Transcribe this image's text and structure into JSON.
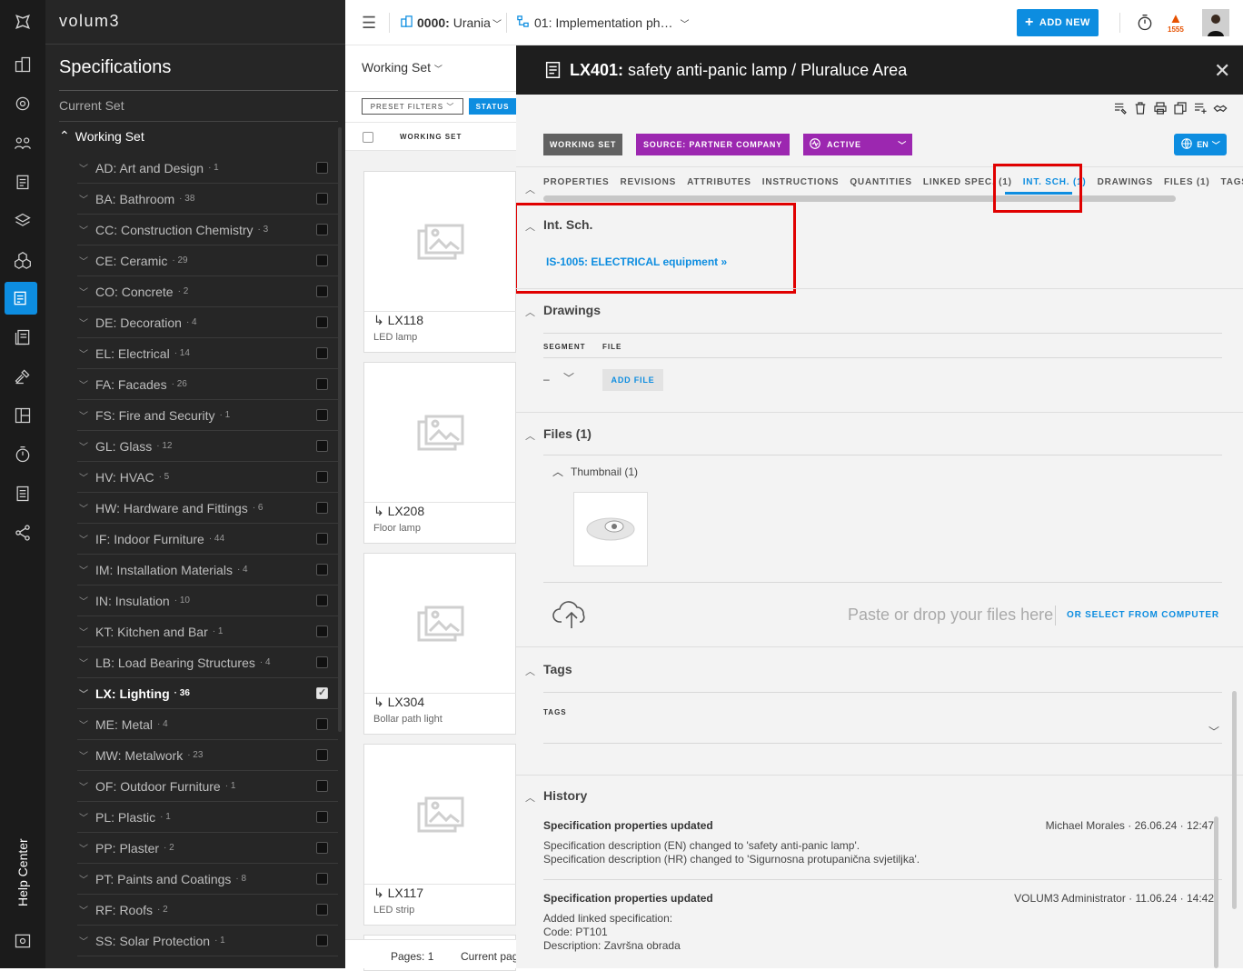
{
  "brand": "volum3",
  "rail": {
    "help": "Help Center"
  },
  "sidebar": {
    "title": "Specifications",
    "current_set": "Current Set",
    "working_set": "Working Set",
    "categories": [
      {
        "label": "AD: Art and Design",
        "count": "· 1"
      },
      {
        "label": "BA: Bathroom",
        "count": "· 38"
      },
      {
        "label": "CC: Construction Chemistry",
        "count": "· 3"
      },
      {
        "label": "CE: Ceramic",
        "count": "· 29"
      },
      {
        "label": "CO: Concrete",
        "count": "· 2"
      },
      {
        "label": "DE: Decoration",
        "count": "· 4"
      },
      {
        "label": "EL: Electrical",
        "count": "· 14"
      },
      {
        "label": "FA: Facades",
        "count": "· 26"
      },
      {
        "label": "FS: Fire and Security",
        "count": "· 1"
      },
      {
        "label": "GL: Glass",
        "count": "· 12"
      },
      {
        "label": "HV: HVAC",
        "count": "· 5"
      },
      {
        "label": "HW: Hardware and Fittings",
        "count": "· 6"
      },
      {
        "label": "IF: Indoor Furniture",
        "count": "· 44"
      },
      {
        "label": "IM: Installation Materials",
        "count": "· 4"
      },
      {
        "label": "IN: Insulation",
        "count": "· 10"
      },
      {
        "label": "KT: Kitchen and Bar",
        "count": "· 1"
      },
      {
        "label": "LB: Load Bearing Structures",
        "count": "· 4"
      },
      {
        "label": "LX: Lighting",
        "count": "· 36"
      },
      {
        "label": "ME: Metal",
        "count": "· 4"
      },
      {
        "label": "MW: Metalwork",
        "count": "· 23"
      },
      {
        "label": "OF: Outdoor Furniture",
        "count": "· 1"
      },
      {
        "label": "PL: Plastic",
        "count": "· 1"
      },
      {
        "label": "PP: Plaster",
        "count": "· 2"
      },
      {
        "label": "PT: Paints and Coatings",
        "count": "· 8"
      },
      {
        "label": "RF: Roofs",
        "count": "· 2"
      },
      {
        "label": "SS: Solar Protection",
        "count": "· 1"
      }
    ]
  },
  "topbar": {
    "project": "0000:",
    "project_name": "Urania",
    "phase": "01: Implementation ph…",
    "add_new": "ADD NEW",
    "notif_count": "1555"
  },
  "list": {
    "working_set": "Working Set",
    "preset_filters": "PRESET FILTERS",
    "status": "STATUS",
    "header": "WORKING SET",
    "cards": [
      {
        "code": "LX118",
        "desc": "LED lamp"
      },
      {
        "code": "LX208",
        "desc": "Floor lamp"
      },
      {
        "code": "LX304",
        "desc": "Bollar path light"
      },
      {
        "code": "LX117",
        "desc": "LED strip"
      }
    ],
    "pages": "Pages: 1",
    "current_page": "Current pag"
  },
  "detail": {
    "code": "LX401:",
    "title": "safety anti-panic lamp / Pluraluce Area",
    "badges": {
      "working_set": "WORKING SET",
      "source": "SOURCE: PARTNER COMPANY",
      "active": "ACTIVE"
    },
    "lang": "EN",
    "tabs": [
      "PROPERTIES",
      "REVISIONS",
      "ATTRIBUTES",
      "INSTRUCTIONS",
      "QUANTITIES",
      "LINKED SPEC. (1)",
      "INT. SCH. (1)",
      "DRAWINGS",
      "FILES (1)",
      "TAGS"
    ],
    "int_sch": {
      "title": "Int. Sch.",
      "link": "IS-1005: ELECTRICAL equipment »"
    },
    "drawings": {
      "title": "Drawings",
      "col_segment": "SEGMENT",
      "col_file": "FILE",
      "segment_value": "–",
      "add_file": "ADD FILE"
    },
    "files": {
      "title": "Files (1)",
      "thumbnail": "Thumbnail (1)",
      "drop_text": "Paste or drop your files here",
      "select": "OR SELECT FROM COMPUTER"
    },
    "tags": {
      "title": "Tags",
      "label": "TAGS"
    },
    "history": {
      "title": "History",
      "entries": [
        {
          "title": "Specification properties updated",
          "meta": "Michael Morales · 26.06.24 · 12:47",
          "lines": [
            "Specification description (EN) changed to 'safety anti-panic lamp'.",
            "Specification description (HR) changed to 'Sigurnosna protupanična svjetiljka'."
          ]
        },
        {
          "title": "Specification properties updated",
          "meta": "VOLUM3 Administrator · 11.06.24 · 14:42",
          "lines": [
            "Added linked specification:",
            "Code: PT101",
            "Description: Završna obrada"
          ]
        }
      ]
    }
  },
  "colors": {
    "accent": "#0d8de0",
    "source_badge": "#9c27b0",
    "highlight": "#e00000"
  }
}
